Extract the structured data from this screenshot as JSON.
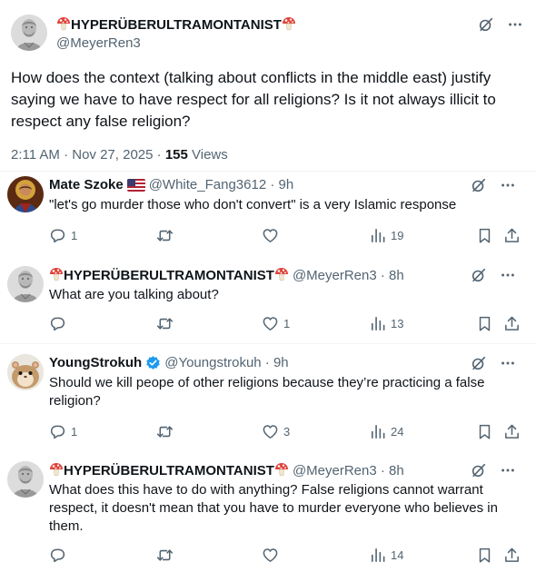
{
  "main_post": {
    "display_name": "HYPERÜBERULTRAMONTANIST",
    "handle": "@MeyerRen3",
    "text": "How does the context (talking about conflicts in the middle east) justify saying we have to have respect for all religions? Is it not always illicit to respect any false religion?",
    "timestamp": "2:11 AM · Nov 27, 2025 · ",
    "views_count": "155",
    "views_label": " Views"
  },
  "replies": [
    {
      "display_name": "Mate Szoke",
      "handle": "@White_Fang3612 · 9h",
      "text": "\"let's go murder those who don't convert\" is a very Islamic response",
      "replies": "1",
      "retweets": "",
      "likes": "",
      "views": "19"
    },
    {
      "display_name": "HYPERÜBERULTRAMONTANIST",
      "handle": "@MeyerRen3 · 8h",
      "text": "What are you talking about?",
      "replies": "",
      "retweets": "",
      "likes": "1",
      "views": "13"
    },
    {
      "display_name": "YoungStrokuh",
      "handle": "@Youngstrokuh · 9h",
      "text": "Should we kill peope of other religions because they’re practicing a false religion?",
      "replies": "1",
      "retweets": "",
      "likes": "3",
      "views": "24"
    },
    {
      "display_name": "HYPERÜBERULTRAMONTANIST",
      "handle": "@MeyerRen3 · 8h",
      "text": "What does this have to do with anything? False religions cannot warrant respect, it doesn't mean that you have to murder everyone who believes in them.",
      "replies": "",
      "retweets": "",
      "likes": "",
      "views": "14"
    }
  ],
  "icons": {
    "grok": "grok-slash-circle-icon",
    "more": "more-dots-icon",
    "reply": "reply-bubble-icon",
    "retweet": "retweet-arrows-icon",
    "like": "heart-icon",
    "views": "bar-chart-icon",
    "bookmark": "bookmark-icon",
    "share": "share-upload-icon",
    "verified": "verified-badge-icon",
    "flag": "us-flag-icon",
    "mushroom": "mushroom-emoji-icon"
  },
  "colors": {
    "text": "#0f1419",
    "secondary": "#536471",
    "verified": "#1d9bf0",
    "divider": "#eff3f4",
    "mushroom_red": "#e0423a"
  }
}
